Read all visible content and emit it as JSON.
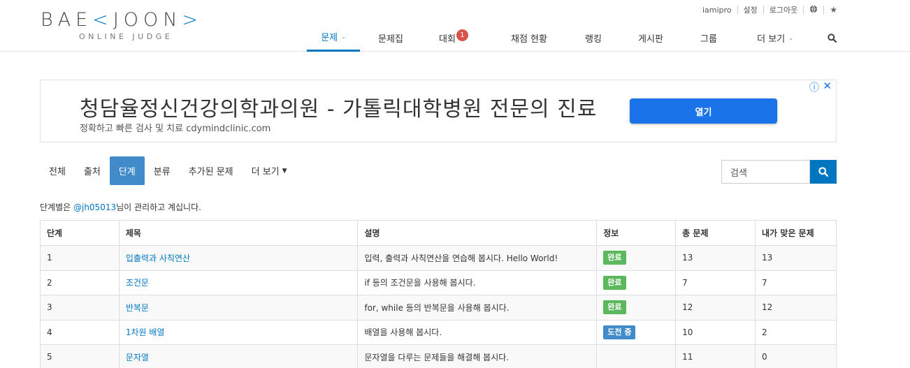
{
  "logo": {
    "left": "BAE",
    "bracket_left": "<",
    "mid": "JOON",
    "bracket_right": ">",
    "sub": "ONLINE JUDGE"
  },
  "topbar": {
    "user": "iamipro",
    "settings": "설정",
    "logout": "로그아웃",
    "globe_icon": "globe-icon",
    "star_icon": "star-icon"
  },
  "nav": {
    "items": [
      {
        "label": "문제",
        "active": true,
        "caret": true
      },
      {
        "label": "문제집"
      },
      {
        "label": "대회",
        "badge": "1"
      },
      {
        "label": "채점 현황"
      },
      {
        "label": "랭킹"
      },
      {
        "label": "게시판"
      },
      {
        "label": "그룹"
      },
      {
        "label": "더 보기",
        "caret": true
      }
    ]
  },
  "ad": {
    "title": "청담율정신건강의학과의원 - 가톨릭대학병원 전문의 진료",
    "subtitle": "정확하고 빠른 검사 및 치료 cdymindclinic.com",
    "button": "열기",
    "info_glyph": "ⓘ",
    "close_glyph": "✕"
  },
  "subnav": {
    "tabs": [
      {
        "label": "전체"
      },
      {
        "label": "출처"
      },
      {
        "label": "단계",
        "active": true
      },
      {
        "label": "분류"
      },
      {
        "label": "추가된 문제"
      },
      {
        "label": "더 보기"
      }
    ],
    "search_placeholder": "검색"
  },
  "manager": {
    "prefix": "단계별은 ",
    "user": "@jh05013",
    "suffix": "님이 관리하고 계십니다."
  },
  "table": {
    "headers": [
      "단계",
      "제목",
      "설명",
      "정보",
      "총 문제",
      "내가 맞은 문제"
    ],
    "rows": [
      {
        "step": "1",
        "title": "입출력과 사칙연산",
        "desc": "입력, 출력과 사칙연산을 연습해 봅시다. Hello World!",
        "info": "완료",
        "info_type": "done",
        "total": "13",
        "mine": "13"
      },
      {
        "step": "2",
        "title": "조건문",
        "desc": "if 등의 조건문을 사용해 봅시다.",
        "info": "완료",
        "info_type": "done",
        "total": "7",
        "mine": "7"
      },
      {
        "step": "3",
        "title": "반복문",
        "desc": "for, while 등의 반복문을 사용해 봅시다.",
        "info": "완료",
        "info_type": "done",
        "total": "12",
        "mine": "12"
      },
      {
        "step": "4",
        "title": "1차원 배열",
        "desc": "배열을 사용해 봅시다.",
        "info": "도전 중",
        "info_type": "prog",
        "total": "10",
        "mine": "2"
      },
      {
        "step": "5",
        "title": "문자열",
        "desc": "문자열을 다루는 문제들을 해결해 봅시다.",
        "info": "",
        "info_type": "",
        "total": "11",
        "mine": "0"
      }
    ]
  },
  "colors": {
    "accent": "#0076c0",
    "tab_active": "#428bca",
    "done": "#5cb85c",
    "badge_red": "#d9534f",
    "ad_button": "#1a73e8"
  }
}
